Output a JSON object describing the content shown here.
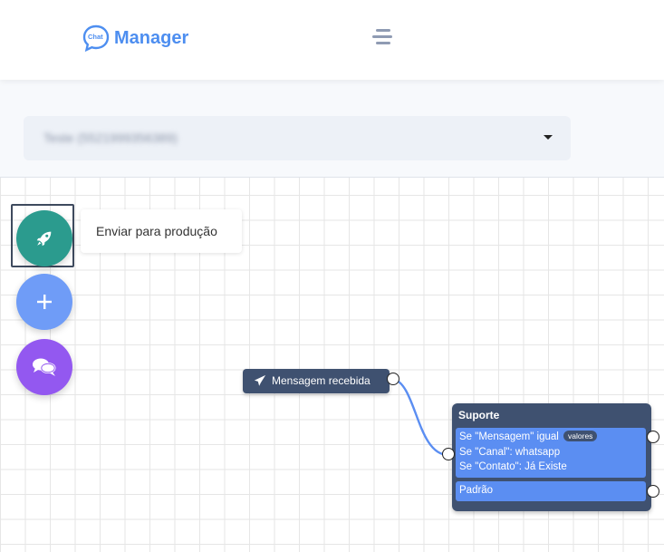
{
  "header": {
    "logo_small": "Chat",
    "logo_text": "Manager"
  },
  "toolbar": {
    "select_value": "Teste (5521999356389)"
  },
  "fabs": {
    "deploy_tooltip": "Enviar para produção"
  },
  "flow": {
    "start_node": {
      "label": "Mensagem recebida"
    },
    "support_node": {
      "title": "Suporte",
      "conditions": [
        {
          "text": "Se \"Mensagem\" igual",
          "badge": "valores"
        },
        {
          "text": "Se \"Canal\": whatsapp"
        },
        {
          "text": "Se \"Contato\": Já Existe"
        }
      ],
      "default_label": "Padrão"
    }
  },
  "colors": {
    "brand": "#4d8ef0",
    "deploy": "#2b9b8e",
    "add": "#6f9cf7",
    "chat": "#9358f0",
    "node": "#3f5170",
    "condition": "#5b8ef2",
    "connector": "#5b8ef2"
  },
  "icons": {
    "menu": "hamburger-menu-icon",
    "deploy": "rocket-icon",
    "add": "plus-icon",
    "chat": "chat-bubbles-icon",
    "start": "paper-plane-icon",
    "select": "caret-down-icon"
  }
}
